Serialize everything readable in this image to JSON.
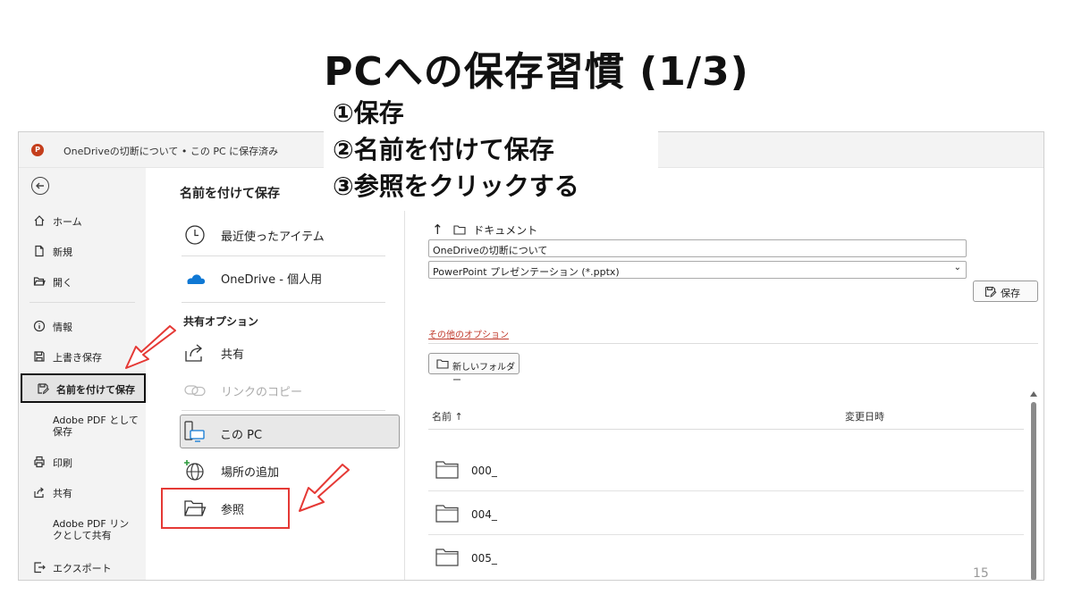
{
  "slide": {
    "title": "PCへの保存習慣 (1/3)",
    "page_number": "15",
    "callout": [
      "①保存",
      "②名前を付けて保存",
      "③参照をクリックする"
    ]
  },
  "window": {
    "doc_title": "OneDriveの切断について • この PC に保存済み",
    "app_icon_letter": "P"
  },
  "sidebar": {
    "items": [
      {
        "label": "ホーム",
        "icon": "home-icon"
      },
      {
        "label": "新規",
        "icon": "new-file-icon"
      },
      {
        "label": "開く",
        "icon": "open-folder-icon"
      },
      {
        "label": "情報",
        "icon": "info-icon"
      },
      {
        "label": "上書き保存",
        "icon": "save-icon"
      },
      {
        "label": "名前を付けて保存",
        "icon": "save-as-icon",
        "active": true
      },
      {
        "label": "Adobe PDF として保存"
      },
      {
        "label": "印刷",
        "icon": "print-icon"
      },
      {
        "label": "共有",
        "icon": "share-icon"
      },
      {
        "label": "Adobe PDF リンクとして共有"
      },
      {
        "label": "エクスポート",
        "icon": "export-icon"
      }
    ]
  },
  "middle": {
    "heading": "名前を付けて保存",
    "recent": "最近使ったアイテム",
    "onedrive": "OneDrive - 個人用",
    "share_heading": "共有オプション",
    "share": "共有",
    "link_copy": "リンクのコピー",
    "this_pc": "この PC",
    "add_place": "場所の追加",
    "browse": "参照"
  },
  "right": {
    "path": "ドキュメント",
    "filename": "OneDriveの切断について",
    "filetype": "PowerPoint プレゼンテーション (*.pptx)",
    "save_label": "保存",
    "more_options": "その他のオプション",
    "new_folder": "新しいフォルダー",
    "col_name": "名前 ↑",
    "col_modified": "変更日時",
    "files": [
      "000_",
      "004_",
      "005_"
    ]
  },
  "colors": {
    "accent_red": "#e53935",
    "ppt_red": "#c43e1c",
    "onedrive_blue": "#0f78d4"
  }
}
